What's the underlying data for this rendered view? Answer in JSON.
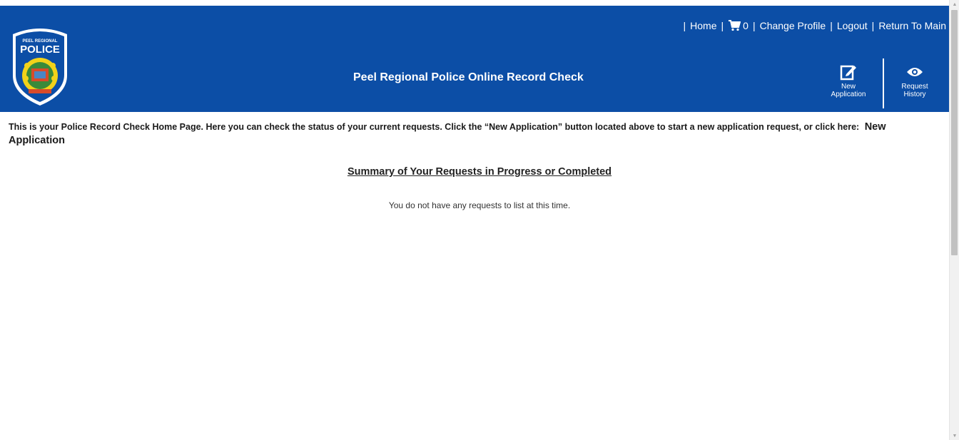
{
  "header": {
    "logo": {
      "top_text": "PEEL REGIONAL",
      "main_text": "POLICE"
    },
    "nav": {
      "home": "Home",
      "cart_count": "0",
      "change_profile": "Change Profile",
      "logout": "Logout",
      "return_main": "Return To Main",
      "separator": "|"
    },
    "title": "Peel Regional Police Online Record Check",
    "new_application": {
      "line1": "New",
      "line2": "Application",
      "icon": "edit-icon"
    },
    "request_history": {
      "line1": "Request",
      "line2": "History",
      "icon": "eye-icon"
    }
  },
  "main": {
    "intro_text": "This is your Police Record Check Home Page. Here you can check the status of your current requests. Click the “New Application” button located above to start a new application request, or click here:",
    "intro_link": "New Application",
    "summary_title": "Summary of Your Requests in Progress or Completed",
    "empty_message": "You do not have any requests to list at this time."
  },
  "colors": {
    "header_bg": "#0c4ea6",
    "header_text": "#ffffff",
    "body_text": "#1a1a1a"
  }
}
